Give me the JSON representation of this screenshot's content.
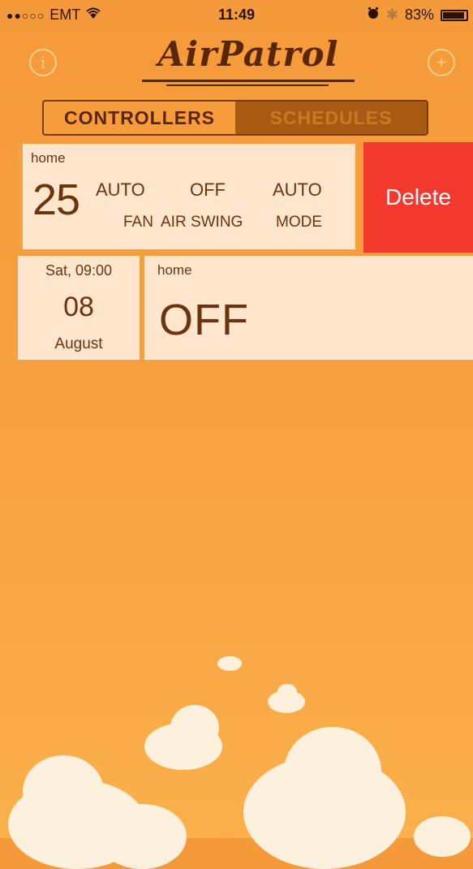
{
  "status_bar": {
    "signal_dots": "●●○○○",
    "carrier": "EMT",
    "wifi_icon": "wifi-icon",
    "time": "11:49",
    "alarm_icon": "alarm-icon",
    "bluetooth_icon": "bluetooth-icon",
    "battery_percent": "83%"
  },
  "header": {
    "logo_text": "AirPatrol",
    "info_label": "i",
    "add_label": "+"
  },
  "tabs": [
    {
      "label": "CONTROLLERS",
      "selected": true
    },
    {
      "label": "SCHEDULES",
      "selected": false
    }
  ],
  "schedules": [
    {
      "name": "home",
      "temperature": "25",
      "fan_value": "AUTO",
      "fan_label": "FAN",
      "swing_value": "OFF",
      "swing_label": "AIR SWING",
      "mode_value": "AUTO",
      "mode_label": "MODE",
      "delete_label": "Delete"
    },
    {
      "weekday_time": "Sat, 09:00",
      "day": "08",
      "month": "August",
      "name": "home",
      "state": "OFF"
    }
  ],
  "colors": {
    "background_top": "#f59a3a",
    "background_bottom": "#fbb04b",
    "card": "#fde6cc",
    "delete": "#f43a2e",
    "text": "#6b3410"
  }
}
